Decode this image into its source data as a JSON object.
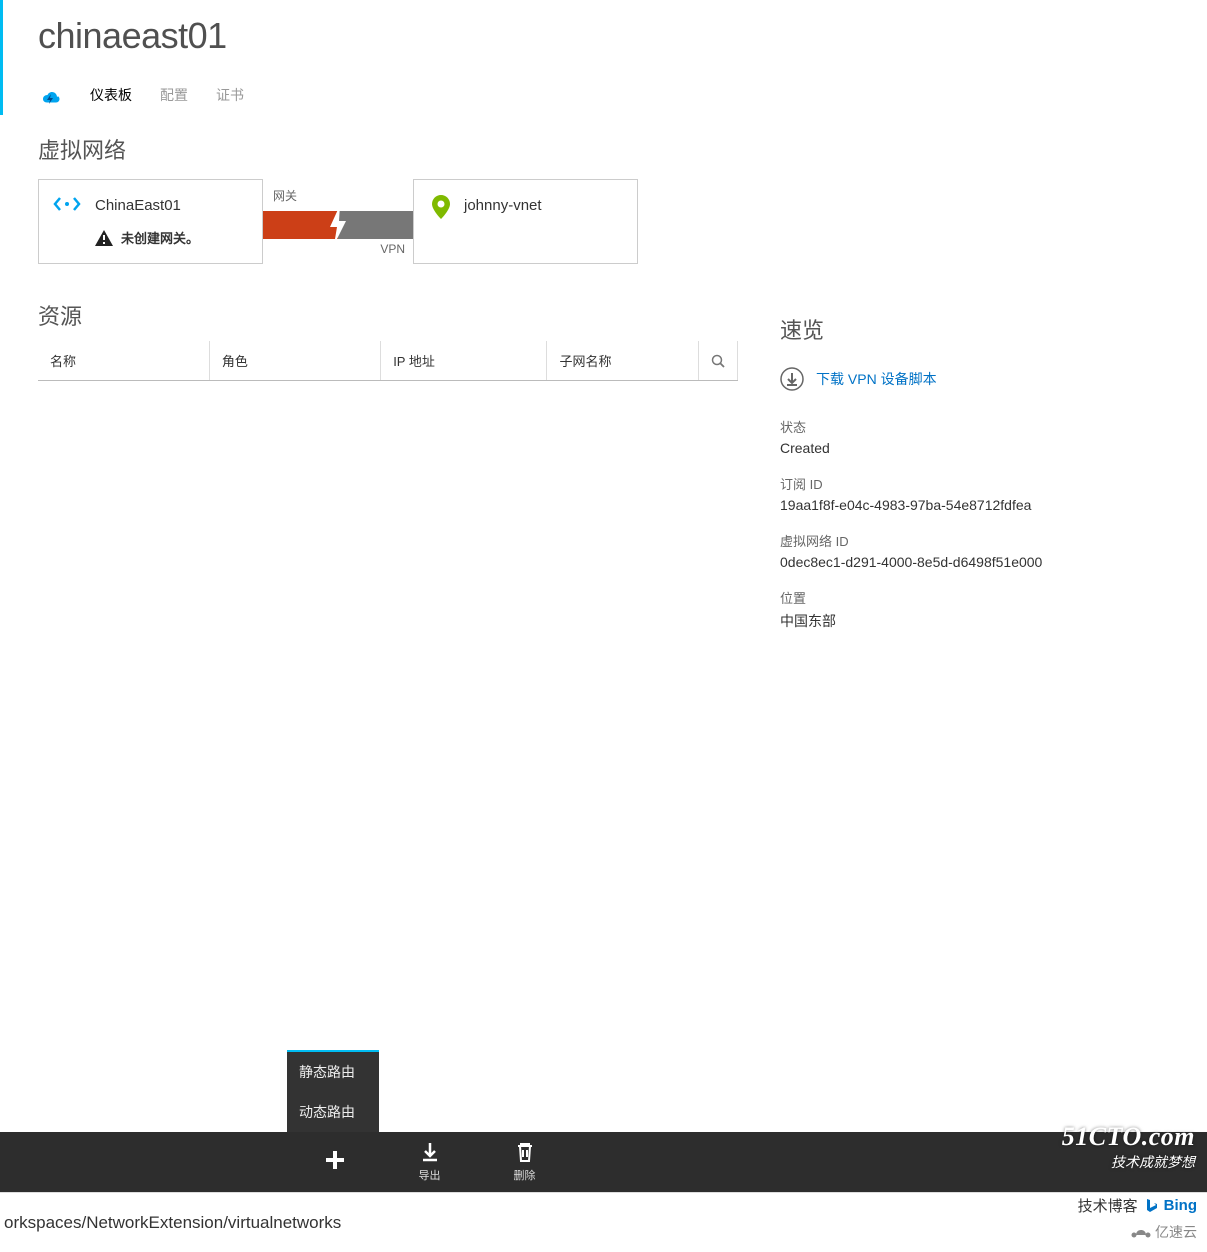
{
  "header": {
    "title": "chinaeast01"
  },
  "tabs": {
    "dashboard": "仪表板",
    "configure": "配置",
    "certificates": "证书"
  },
  "network": {
    "section_title": "虚拟网络",
    "local": {
      "name": "ChinaEast01",
      "warning": "未创建网关。"
    },
    "gateway": {
      "top_label": "网关",
      "bottom_label": "VPN"
    },
    "remote": {
      "name": "johnny-vnet"
    }
  },
  "resources": {
    "title": "资源",
    "headers": {
      "name": "名称",
      "role": "角色",
      "ip": "IP 地址",
      "subnet": "子网名称"
    }
  },
  "overview": {
    "title": "速览",
    "download_link": "下载 VPN 设备脚本",
    "status_label": "状态",
    "status_value": "Created",
    "sub_label": "订阅 ID",
    "sub_value": "19aa1f8f-e04c-4983-97ba-54e8712fdfea",
    "vnet_label": "虚拟网络 ID",
    "vnet_value": "0dec8ec1-d291-4000-8e5d-d6498f51e000",
    "loc_label": "位置",
    "loc_value": "中国东部"
  },
  "popup": {
    "static": "静态路由",
    "dynamic": "动态路由"
  },
  "bottombar": {
    "add": "",
    "export": "导出",
    "delete": "删除"
  },
  "path": {
    "text": "orkspaces/NetworkExtension/virtualnetworks",
    "blog_label": "技术博客",
    "bing": "Bing",
    "yisu": "亿速云"
  },
  "watermark": {
    "main": "51CTO.com",
    "sub": "技术成就梦想"
  }
}
